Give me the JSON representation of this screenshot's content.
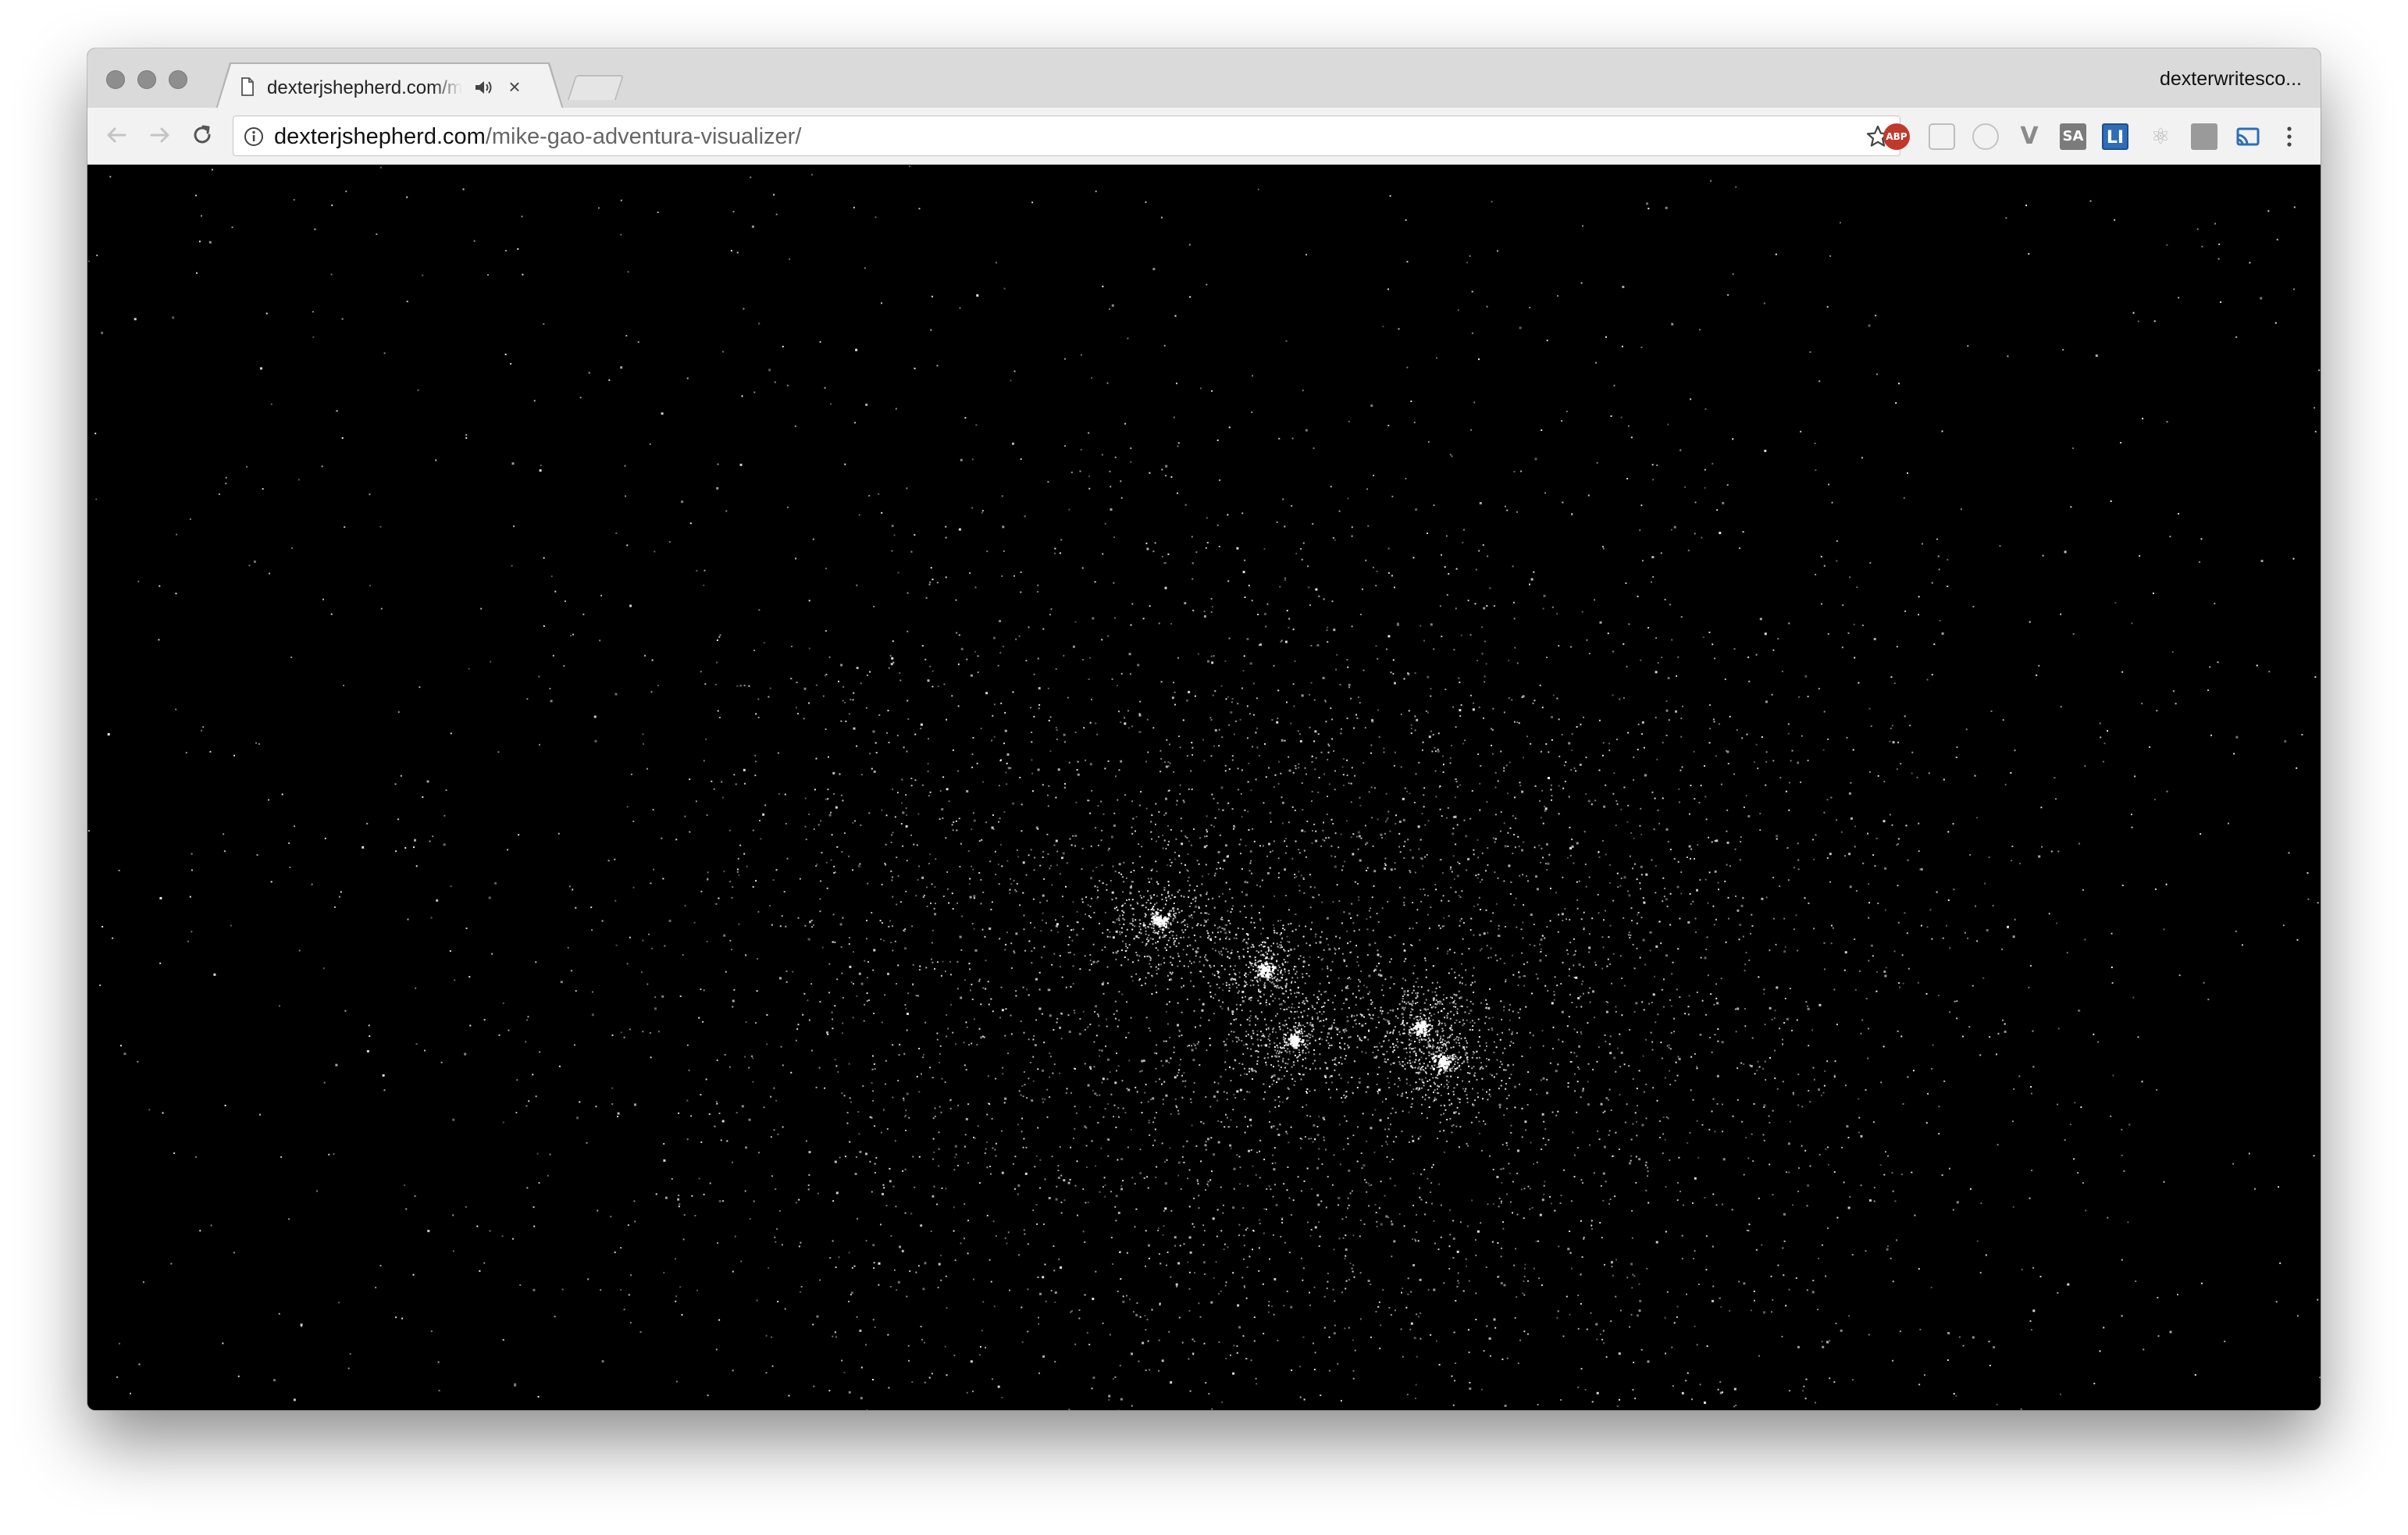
{
  "window": {
    "controls": [
      "close",
      "minimize",
      "zoom"
    ]
  },
  "tab": {
    "title": "dexterjshepherd.com/mike-gao-adventura-visualizer/",
    "favicon": "page-icon",
    "audio_icon": "speaker-icon",
    "close_label": "×"
  },
  "profile": {
    "name": "dexterwritesco..."
  },
  "toolbar": {
    "back_icon": "back-arrow-icon",
    "forward_icon": "forward-arrow-icon",
    "reload_icon": "reload-icon",
    "url_host": "dexterjshepherd.com",
    "url_path": "/mike-gao-adventura-visualizer/",
    "bookmark_icon": "star-icon",
    "menu_icon": "kebab-menu-icon"
  },
  "extensions": [
    {
      "name": "adblock-plus",
      "label": "ABP",
      "color": "#c0392b"
    },
    {
      "name": "comment-extension",
      "label": ""
    },
    {
      "name": "circle-extension",
      "label": ""
    },
    {
      "name": "v-extension",
      "label": "V"
    },
    {
      "name": "sa-extension",
      "label": "SA",
      "color": "#7b7b7b"
    },
    {
      "name": "li-extension",
      "label": "LI",
      "color": "#2f6db7"
    },
    {
      "name": "react-devtools",
      "label": "⚛"
    },
    {
      "name": "reader-extension",
      "label": ""
    },
    {
      "name": "cast-extension",
      "label": "",
      "color": "#2f6db7"
    }
  ],
  "content": {
    "background": "#000000",
    "star_color": "#ffffff"
  }
}
